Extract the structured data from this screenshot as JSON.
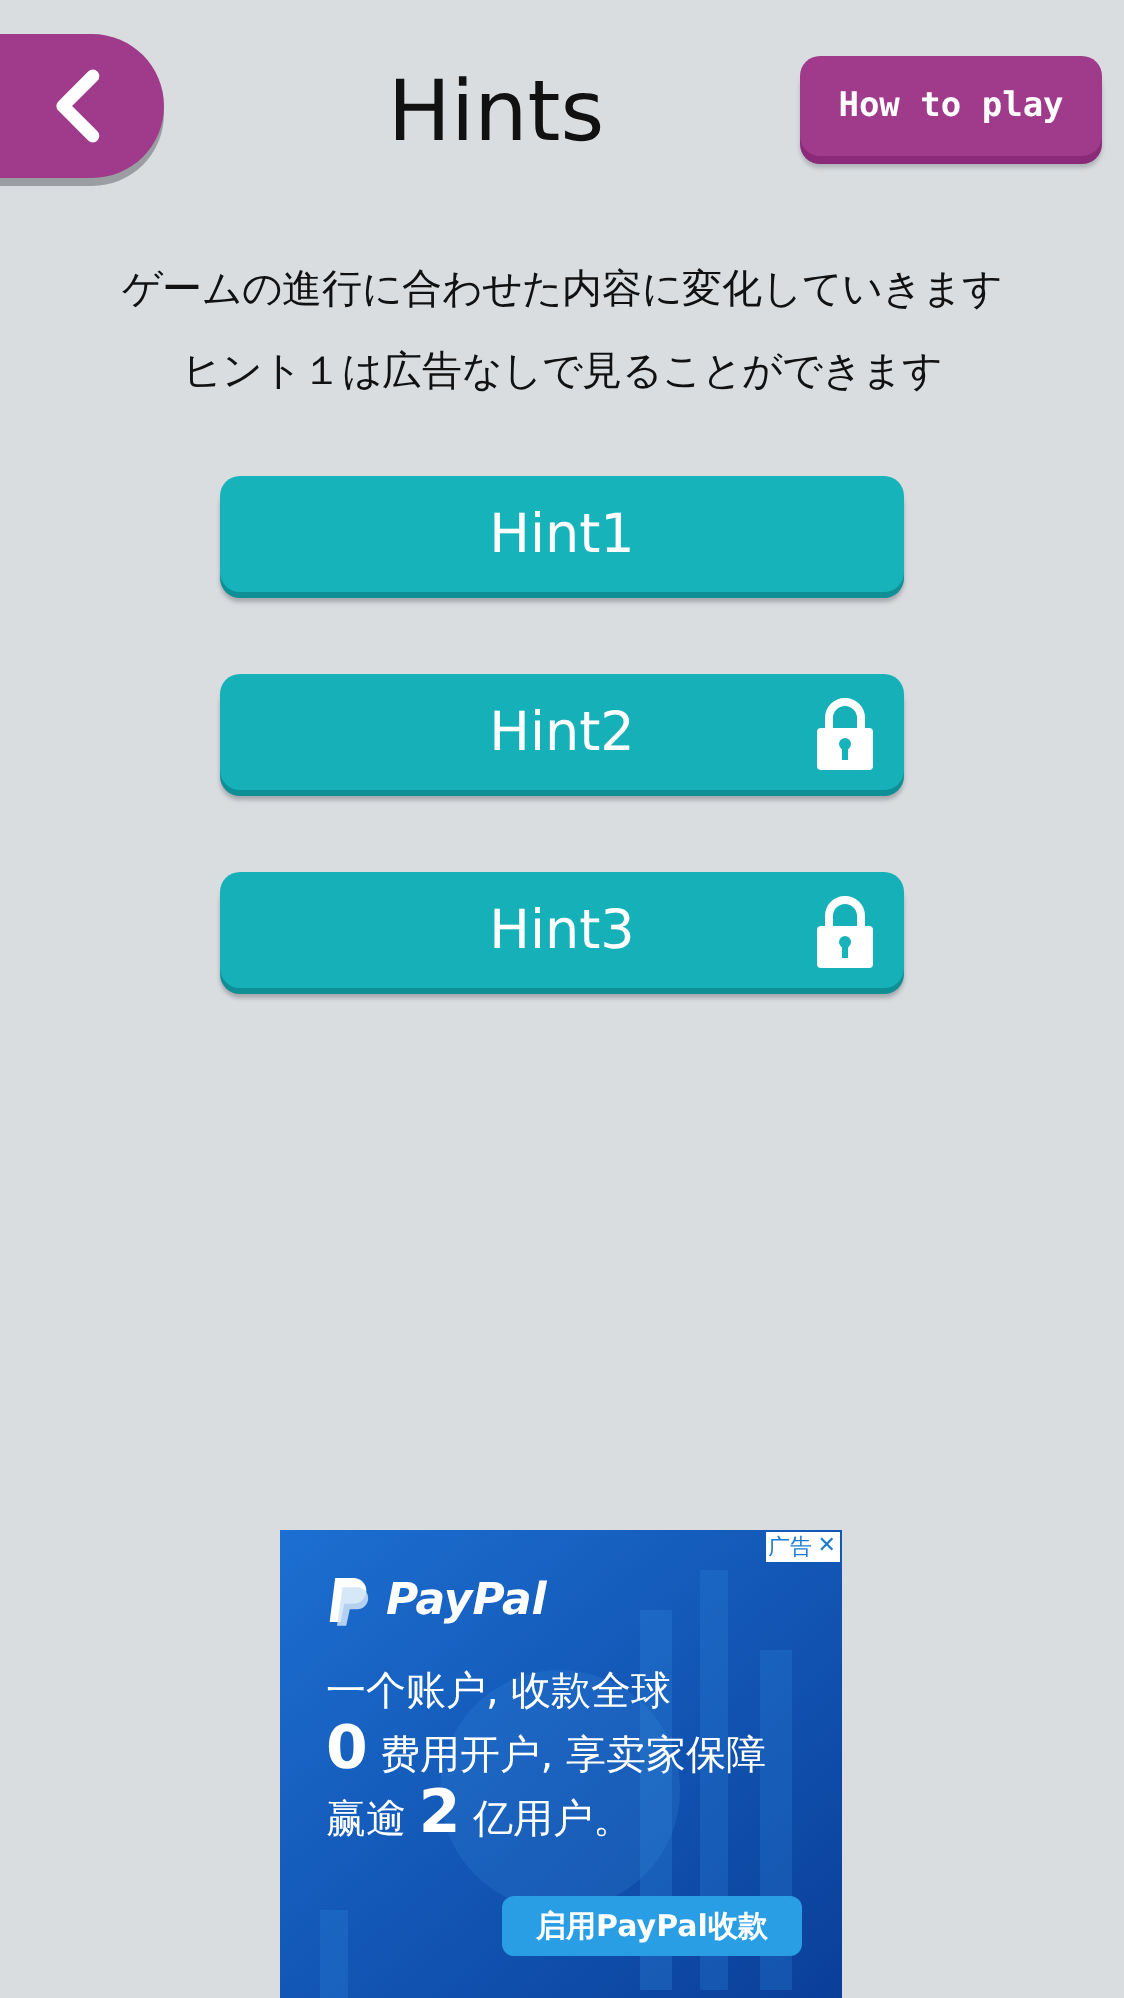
{
  "header": {
    "title": "Hints",
    "how_to_play": "How to play"
  },
  "intro": [
    "ゲームの進行に合わせた内容に変化していきます",
    "ヒント１は広告なしで見ることができます"
  ],
  "hints": [
    {
      "label": "Hint1",
      "locked": false
    },
    {
      "label": "Hint2",
      "locked": true
    },
    {
      "label": "Hint3",
      "locked": true
    }
  ],
  "ad": {
    "badge": "广告",
    "close": "✕",
    "brand": "PayPal",
    "lines": [
      "一个账户, 收款全球",
      "**0** 费用开户, 享卖家保障",
      "赢逾 **2** 亿用户。"
    ],
    "cta": "启用PayPal收款"
  }
}
